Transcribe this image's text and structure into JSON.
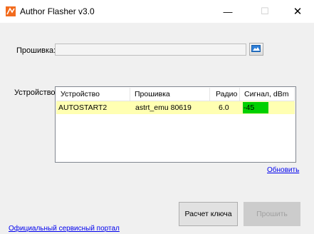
{
  "window": {
    "title": "Author Flasher v3.0",
    "minimize_glyph": "—",
    "maximize_glyph": "☐",
    "close_glyph": "✕",
    "app_icon": "author-flasher-logo-icon"
  },
  "firmware": {
    "label": "Прошивка:",
    "value": "",
    "browse_icon": "folder-open-icon"
  },
  "devices": {
    "label": "Устройство:",
    "columns": [
      "Устройство",
      "Прошивка",
      "Радио",
      "Сигнал, dBm"
    ],
    "rows": [
      {
        "device": "AUTOSTART2",
        "firmware": "astrt_emu 80619",
        "radio": "6.0",
        "signal": "-45"
      }
    ],
    "row_highlight_color": "#ffffb2",
    "signal_color": "#00d000",
    "refresh_link": "Обновить"
  },
  "buttons": {
    "key_calc": "Расчет ключа",
    "flash": "Прошить"
  },
  "footer": {
    "portal_link": "Официальный сервисный портал"
  }
}
